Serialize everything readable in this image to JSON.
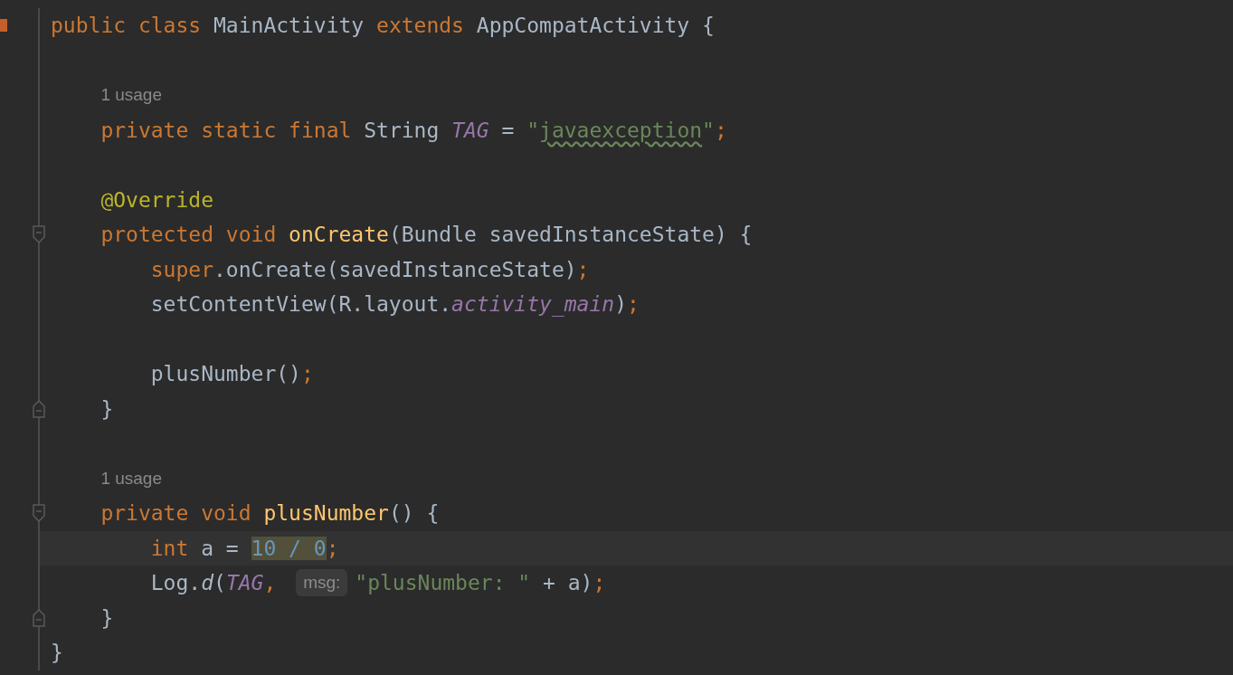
{
  "editor": {
    "lines": [
      {
        "kind": "code",
        "changed": true,
        "tokens": [
          {
            "text": "public class ",
            "kind": "keyword"
          },
          {
            "text": "MainActivity ",
            "kind": "plain"
          },
          {
            "text": "extends ",
            "kind": "keyword"
          },
          {
            "text": "AppCompatActivity {",
            "kind": "plain"
          }
        ]
      },
      {
        "kind": "blank"
      },
      {
        "kind": "usage",
        "text": "1 usage"
      },
      {
        "kind": "code",
        "tokens": [
          {
            "text": "    private static final ",
            "kind": "keyword"
          },
          {
            "text": "String ",
            "kind": "plain"
          },
          {
            "text": "TAG",
            "kind": "constant"
          },
          {
            "text": " = ",
            "kind": "plain"
          },
          {
            "text": "\"",
            "kind": "string"
          },
          {
            "text": "javaexception",
            "kind": "string",
            "typo": true
          },
          {
            "text": "\"",
            "kind": "string"
          },
          {
            "text": ";",
            "kind": "punct"
          }
        ]
      },
      {
        "kind": "blank"
      },
      {
        "kind": "code",
        "tokens": [
          {
            "text": "    @Override",
            "kind": "annotation"
          }
        ]
      },
      {
        "kind": "code",
        "fold_start": true,
        "tokens": [
          {
            "text": "    protected void ",
            "kind": "keyword"
          },
          {
            "text": "onCreate",
            "kind": "declaration"
          },
          {
            "text": "(Bundle savedInstanceState) {",
            "kind": "plain"
          }
        ]
      },
      {
        "kind": "code",
        "tokens": [
          {
            "text": "        super",
            "kind": "keyword"
          },
          {
            "text": ".onCreate(savedInstanceState)",
            "kind": "plain"
          },
          {
            "text": ";",
            "kind": "punct"
          }
        ]
      },
      {
        "kind": "code",
        "tokens": [
          {
            "text": "        setContentView(R.layout.",
            "kind": "plain"
          },
          {
            "text": "activity_main",
            "kind": "constant"
          },
          {
            "text": ")",
            "kind": "plain"
          },
          {
            "text": ";",
            "kind": "punct"
          }
        ]
      },
      {
        "kind": "blank"
      },
      {
        "kind": "code",
        "tokens": [
          {
            "text": "        plusNumber()",
            "kind": "plain"
          },
          {
            "text": ";",
            "kind": "punct"
          }
        ]
      },
      {
        "kind": "code",
        "fold_end": true,
        "tokens": [
          {
            "text": "    }",
            "kind": "plain"
          }
        ]
      },
      {
        "kind": "blank"
      },
      {
        "kind": "usage",
        "text": "1 usage"
      },
      {
        "kind": "code",
        "fold_start": true,
        "tokens": [
          {
            "text": "    private void ",
            "kind": "keyword"
          },
          {
            "text": "plusNumber",
            "kind": "declaration"
          },
          {
            "text": "() {",
            "kind": "plain"
          }
        ]
      },
      {
        "kind": "code",
        "current": true,
        "tokens": [
          {
            "text": "        int ",
            "kind": "keyword"
          },
          {
            "text": "a = ",
            "kind": "plain"
          },
          {
            "text": "10 / 0",
            "kind": "number",
            "highlighted": true
          },
          {
            "text": ";",
            "kind": "punct"
          }
        ]
      },
      {
        "kind": "code",
        "tokens": [
          {
            "text": "        Log.",
            "kind": "plain"
          },
          {
            "text": "d",
            "kind": "static_call"
          },
          {
            "text": "(",
            "kind": "plain"
          },
          {
            "text": "TAG",
            "kind": "constant"
          },
          {
            "text": ", ",
            "kind": "punct"
          },
          {
            "text": "msg:",
            "kind": "param_hint"
          },
          {
            "text": "\"plusNumber: \"",
            "kind": "string"
          },
          {
            "text": " + a)",
            "kind": "plain"
          },
          {
            "text": ";",
            "kind": "punct"
          }
        ]
      },
      {
        "kind": "code",
        "fold_end": true,
        "tokens": [
          {
            "text": "    }",
            "kind": "plain"
          }
        ]
      },
      {
        "kind": "code",
        "tokens": [
          {
            "text": "}",
            "kind": "plain"
          }
        ]
      }
    ]
  }
}
